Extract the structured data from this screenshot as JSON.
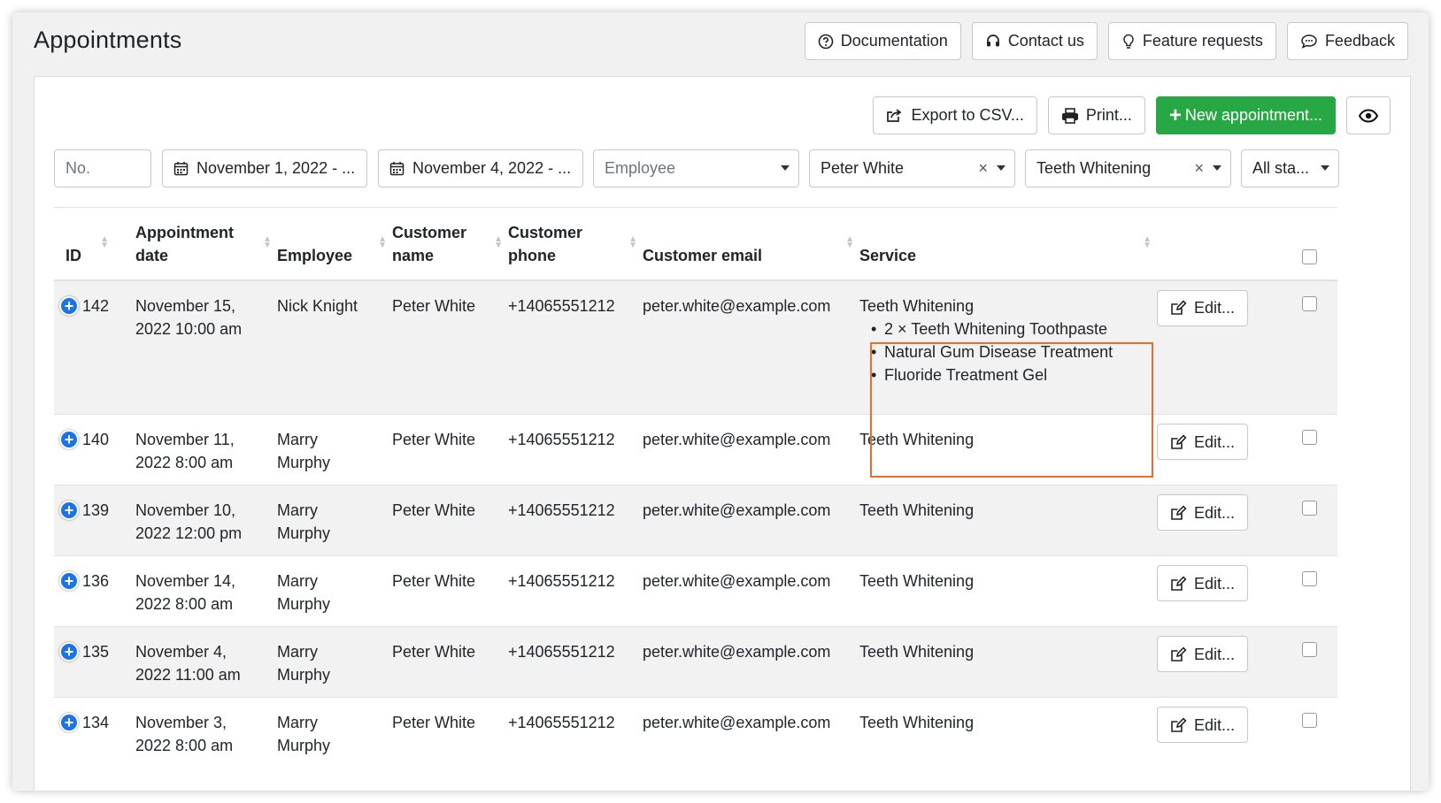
{
  "page": {
    "title": "Appointments"
  },
  "top_actions": [
    {
      "label": "Documentation",
      "icon": "question-circle-icon"
    },
    {
      "label": "Contact us",
      "icon": "headset-icon"
    },
    {
      "label": "Feature requests",
      "icon": "lightbulb-icon"
    },
    {
      "label": "Feedback",
      "icon": "chat-bubble-icon"
    }
  ],
  "toolbar": {
    "export_label": "Export to CSV...",
    "print_label": "Print...",
    "new_label": "New appointment...",
    "accent_green": "#28a745",
    "highlight_color": "#ed6b2b"
  },
  "filters": {
    "number_placeholder": "No.",
    "date_from": "November 1, 2022 - ...",
    "date_to": "November 4, 2022 - ...",
    "employee_placeholder": "Employee",
    "customer": "Peter White",
    "service": "Teeth Whitening",
    "status": "All sta..."
  },
  "table": {
    "columns": {
      "id": "ID",
      "date_1": "Appointment",
      "date_2": "date",
      "employee": "Employee",
      "customer_1": "Customer",
      "customer_2": "name",
      "phone_1": "Customer",
      "phone_2": "phone",
      "email": "Customer email",
      "service": "Service"
    },
    "edit_label": "Edit...",
    "rows": [
      {
        "id": "142",
        "date_1": "November 15,",
        "date_2": "2022 10:00 am",
        "employee_1": "Nick Knight",
        "employee_2": "",
        "customer": "Peter White",
        "phone": "+14065551212",
        "email": "peter.white@example.com",
        "service": "Teeth Whitening",
        "extras": [
          "2 × Teeth Whitening Toothpaste",
          "Natural Gum Disease Treatment",
          "Fluoride Treatment Gel"
        ]
      },
      {
        "id": "140",
        "date_1": "November 11,",
        "date_2": "2022 8:00 am",
        "employee_1": "Marry",
        "employee_2": "Murphy",
        "customer": "Peter White",
        "phone": "+14065551212",
        "email": "peter.white@example.com",
        "service": "Teeth Whitening"
      },
      {
        "id": "139",
        "date_1": "November 10,",
        "date_2": "2022 12:00 pm",
        "employee_1": "Marry",
        "employee_2": "Murphy",
        "customer": "Peter White",
        "phone": "+14065551212",
        "email": "peter.white@example.com",
        "service": "Teeth Whitening"
      },
      {
        "id": "136",
        "date_1": "November 14,",
        "date_2": "2022 8:00 am",
        "employee_1": "Marry",
        "employee_2": "Murphy",
        "customer": "Peter White",
        "phone": "+14065551212",
        "email": "peter.white@example.com",
        "service": "Teeth Whitening"
      },
      {
        "id": "135",
        "date_1": "November 4,",
        "date_2": "2022 11:00 am",
        "employee_1": "Marry",
        "employee_2": "Murphy",
        "customer": "Peter White",
        "phone": "+14065551212",
        "email": "peter.white@example.com",
        "service": "Teeth Whitening"
      },
      {
        "id": "134",
        "date_1": "November 3,",
        "date_2": "2022 8:00 am",
        "employee_1": "Marry",
        "employee_2": "Murphy",
        "customer": "Peter White",
        "phone": "+14065551212",
        "email": "peter.white@example.com",
        "service": "Teeth Whitening"
      }
    ]
  }
}
